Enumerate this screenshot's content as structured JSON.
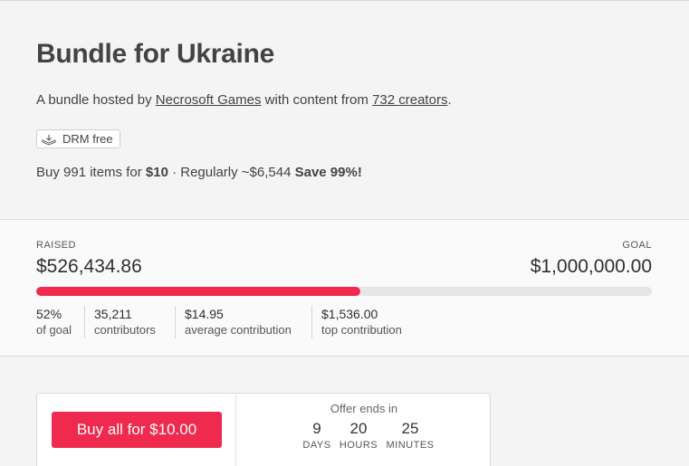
{
  "header": {
    "title": "Bundle for Ukraine",
    "subtitle_prefix": "A bundle hosted by ",
    "host_link": "Necrosoft Games",
    "subtitle_middle": " with content from ",
    "creators_link": "732 creators",
    "subtitle_suffix": ".",
    "drm_label": "DRM free",
    "drm_icon": "drm-box-icon",
    "price_prefix": "Buy 991 items for ",
    "price_amount": "$10",
    "price_regular": " · Regularly ~$6,544 ",
    "price_save": "Save 99%!"
  },
  "stats": {
    "raised_label": "RAISED",
    "raised_amount": "$526,434.86",
    "goal_label": "GOAL",
    "goal_amount": "$1,000,000.00",
    "progress_percent": 52.6,
    "progress_color": "#f0294f",
    "items": [
      {
        "value": "52%",
        "label": "of goal"
      },
      {
        "value": "35,211",
        "label": "contributors"
      },
      {
        "value": "$14.95",
        "label": "average contribution"
      },
      {
        "value": "$1,536.00",
        "label": "top contribution"
      }
    ]
  },
  "purchase": {
    "button_label": "Buy all for $10.00",
    "button_color": "#f0294f",
    "offer_label": "Offer ends in",
    "countdown": [
      {
        "value": "9",
        "unit": "DAYS"
      },
      {
        "value": "20",
        "unit": "HOURS"
      },
      {
        "value": "25",
        "unit": "MINUTES"
      }
    ]
  }
}
